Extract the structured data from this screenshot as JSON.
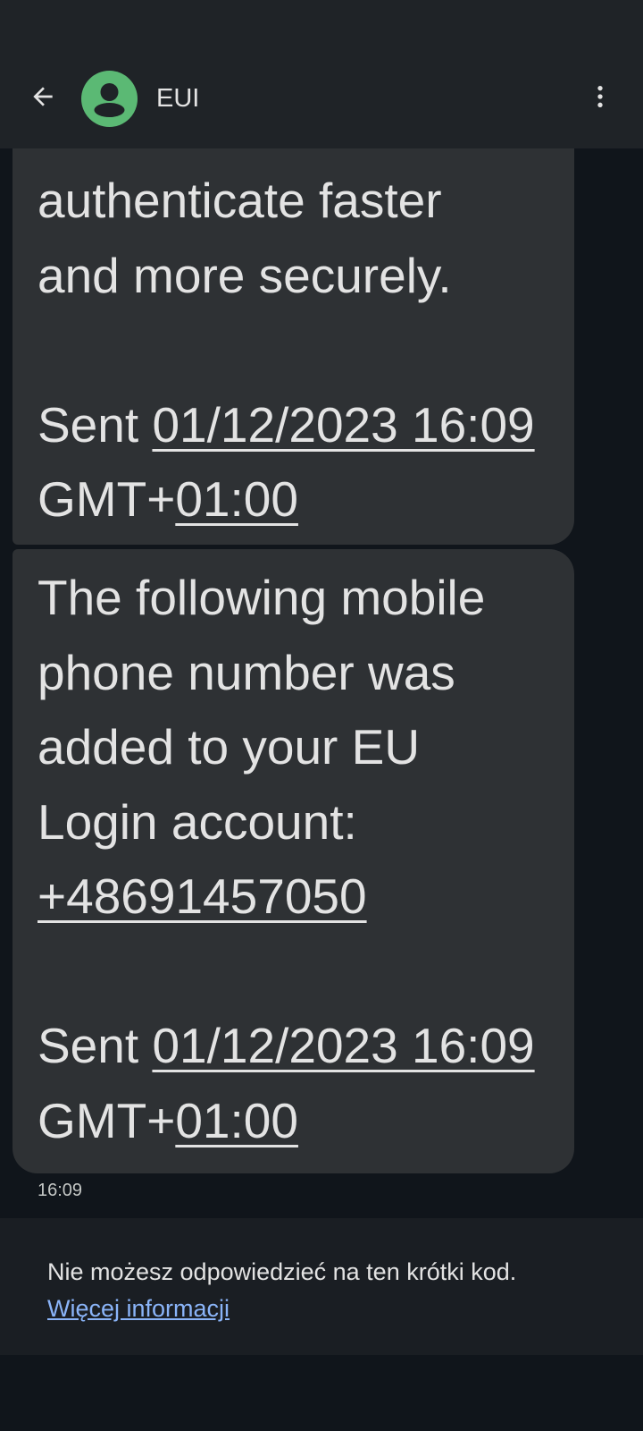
{
  "header": {
    "contact_name": "EUI"
  },
  "icons": {
    "back": "arrow-back-icon",
    "avatar": "person-icon",
    "more": "more-vert-icon"
  },
  "colors": {
    "avatar_bg": "#5bb974",
    "bubble_bg": "#2e3134",
    "link": "#8ab4f8"
  },
  "messages": [
    {
      "lines": [
        {
          "text": "authenticate faster"
        },
        {
          "text": "and more securely."
        },
        {
          "text": ""
        },
        {
          "prefix": "Sent ",
          "link": "01/12/2023 16:09"
        },
        {
          "prefix": "GMT+",
          "link": "01:00"
        }
      ]
    },
    {
      "lines": [
        {
          "text": "The following mobile"
        },
        {
          "text": "phone number was"
        },
        {
          "text": "added to your EU"
        },
        {
          "text": "Login account:"
        },
        {
          "link": "+48691457050"
        },
        {
          "text": ""
        },
        {
          "prefix": "Sent ",
          "link": "01/12/2023 16:09"
        },
        {
          "prefix": "GMT+",
          "link": "01:00"
        }
      ]
    }
  ],
  "timestamp": "16:09",
  "footer": {
    "notice": "Nie możesz odpowiedzieć na ten krótki kod.",
    "more_info_link": "Więcej informacji"
  }
}
